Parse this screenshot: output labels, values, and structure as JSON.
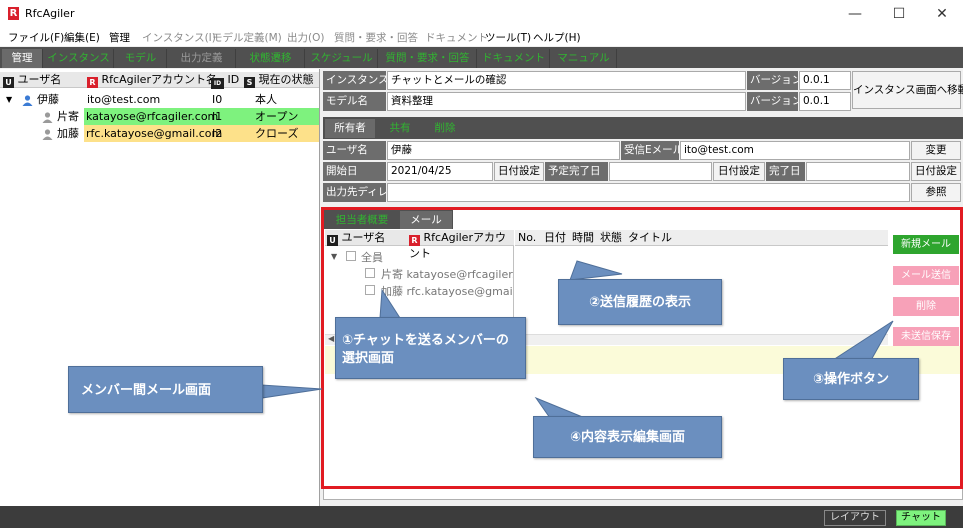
{
  "window": {
    "title": "RfcAgiler",
    "logo_letter": "R",
    "minimize": "—",
    "maximize": "☐",
    "close": "✕"
  },
  "menu": [
    {
      "label": "ファイル(F)",
      "enabled": true
    },
    {
      "label": "編集(E)",
      "enabled": true
    },
    {
      "label": "管理",
      "enabled": true
    },
    {
      "label": "インスタンス(I)",
      "enabled": false
    },
    {
      "label": "モデル定義(M)",
      "enabled": false
    },
    {
      "label": "出力(O)",
      "enabled": false
    },
    {
      "label": "質問・要求・回答",
      "enabled": false
    },
    {
      "label": "ドキュメント",
      "enabled": false
    },
    {
      "label": "ツール(T)",
      "enabled": true
    },
    {
      "label": "ヘルプ(H)",
      "enabled": true
    }
  ],
  "tabs": [
    "管理",
    "インスタンス",
    "モデル",
    "出力定義",
    "状態遷移",
    "スケジュール",
    "質問・要求・回答",
    "ドキュメント",
    "マニュアル"
  ],
  "members": {
    "headers": {
      "user": "ユーザ名",
      "account": "RfcAgilerアカウント名",
      "id": "ID",
      "status": "現在の状態"
    },
    "header_icons": {
      "user": "U",
      "account": "R",
      "id": "ID",
      "status": "S"
    },
    "rows": [
      {
        "expander": "▼",
        "name": "伊藤",
        "account": "ito@test.com",
        "id": "I0",
        "status": "本人"
      },
      {
        "expander": "",
        "name": "片寄",
        "account": "katayose@rfcagiler.com",
        "id": "I1",
        "status": "オープン"
      },
      {
        "expander": "",
        "name": "加藤",
        "account": "rfc.katayose@gmail.com",
        "id": "I2",
        "status": "クローズ"
      }
    ]
  },
  "instance": {
    "name_label": "インスタンス名",
    "name_value": "チャットとメールの確認",
    "version_label": "バージョン",
    "version_value": "0.0.1",
    "model_label": "モデル名",
    "model_value": "資料整理",
    "model_version_label": "バージョン",
    "model_version_value": "0.0.1",
    "move_button": "インスタンス画面へ移動"
  },
  "owner_tabs": [
    "所有者",
    "共有",
    "削除"
  ],
  "owner": {
    "user_label": "ユーザ名",
    "user_value": "伊藤",
    "email_label": "受信Eメール",
    "email_value": "ito@test.com",
    "change_button": "変更",
    "start_label": "開始日",
    "start_value": "2021/04/25",
    "date_set_1": "日付設定",
    "planned_label": "予定完了日",
    "date_set_2": "日付設定",
    "done_label": "完了日",
    "date_set_3": "日付設定",
    "output_label": "出力先ディレ",
    "browse_button": "参照"
  },
  "email_tabs": [
    "担当者概要",
    "メール"
  ],
  "recipients": {
    "user_header": "ユーザ名",
    "account_header": "RfcAgilerアカウント",
    "all_label": "全員",
    "items": [
      {
        "name": "片寄",
        "account": "katayose@rfcagiler.co"
      },
      {
        "name": "加藤",
        "account": "rfc.katayose@gmail.c"
      }
    ]
  },
  "history_headers": [
    "No.",
    "日付",
    "時間",
    "状態",
    "タイトル"
  ],
  "ops": {
    "new": "新規メール",
    "send": "メール送信",
    "delete": "削除",
    "save": "未送信保存"
  },
  "callouts": {
    "member_select": "①チャットを送るメンバーの選択画面",
    "history": "②送信履歴の表示",
    "operations": "③操作ボタン",
    "editor": "④内容表示編集画面",
    "member_mail": "メンバー間メール画面"
  },
  "statusbar": {
    "layout": "レイアウト",
    "chat": "チャット"
  },
  "colors": {
    "accent_green": "#2ea52e",
    "highlight_green": "#7ef27e",
    "highlight_yellow": "#fde18a",
    "red_frame": "#e11b22",
    "callout_blue": "#6b8fbf"
  }
}
